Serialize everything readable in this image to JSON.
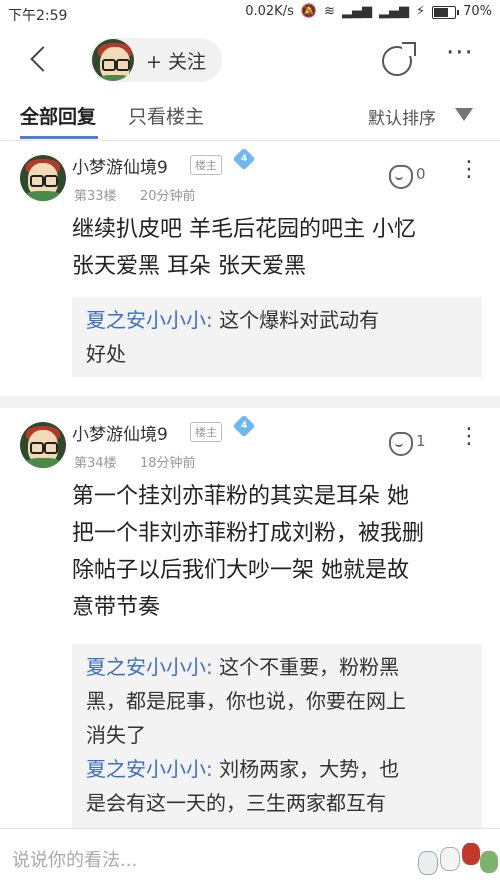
{
  "status_bar": {
    "time": "下午2:59",
    "network_speed": "0.02K/s",
    "battery_percent": "70%",
    "battery_level": 0.7
  },
  "nav": {
    "follow_label": "+ 关注"
  },
  "tabs": {
    "all_replies": "全部回复",
    "op_only": "只看楼主",
    "sort": "默认排序"
  },
  "posts": [
    {
      "username": "小梦游仙境9",
      "badge": "楼主",
      "level": "4",
      "floor": "第33楼",
      "time": "20分钟前",
      "likes": "0",
      "lines": [
        "继续扒皮吧 羊毛后花园的吧主 小忆",
        "张天爱黑 耳朵 张天爱黑"
      ],
      "quotes": [
        {
          "name": "夏之安小小小:",
          "lines": [
            " 这个爆料对武动有",
            "好处"
          ]
        }
      ]
    },
    {
      "username": "小梦游仙境9",
      "badge": "楼主",
      "level": "4",
      "floor": "第34楼",
      "time": "18分钟前",
      "likes": "1",
      "lines": [
        "第一个挂刘亦菲粉的其实是耳朵 她",
        "把一个非刘亦菲粉打成刘粉，被我删",
        "除帖子以后我们大吵一架 她就是故",
        "意带节奏"
      ],
      "quotes": [
        {
          "name": "夏之安小小小:",
          "lines": [
            " 这个不重要，粉粉黑",
            "黑，都是屁事，你也说，你要在网上",
            "消失了"
          ]
        },
        {
          "name": "夏之安小小小:",
          "lines": [
            " 刘杨两家，大势，也",
            "是会有这一天的，三生两家都互有"
          ]
        }
      ]
    }
  ],
  "reply": {
    "placeholder": "说说你的看法..."
  },
  "colors": {
    "accent": "#4a7be8",
    "quote_name": "#3c6fc4",
    "level_badge": "#6fb7ef"
  }
}
